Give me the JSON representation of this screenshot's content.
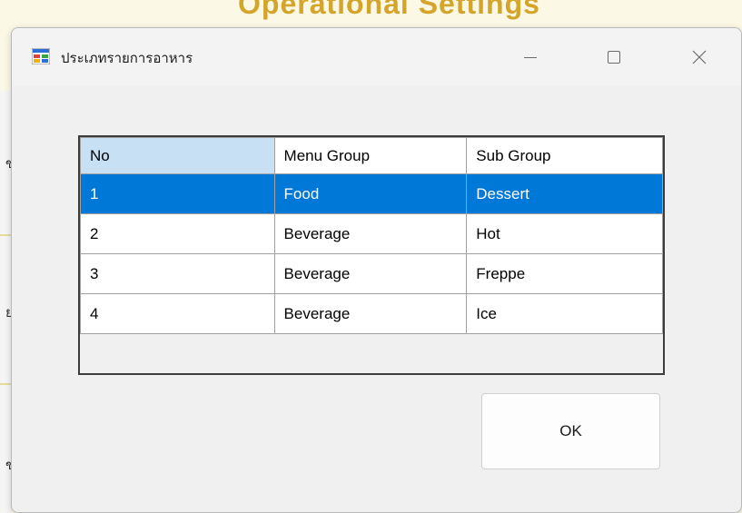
{
  "background_window": {
    "title_fragment": "Operational Settings",
    "edge_glyphs": [
      "ข",
      "ย",
      "ข"
    ]
  },
  "dialog": {
    "title": "ประเภทรายการอาหาร",
    "icon": "windows-form-icon",
    "controls": {
      "minimize": "minimize-icon",
      "maximize": "maximize-icon",
      "close": "close-icon"
    }
  },
  "grid": {
    "columns": [
      "No",
      "Menu Group",
      "Sub Group"
    ],
    "rows": [
      {
        "no": "1",
        "menu_group": "Food",
        "sub_group": "Dessert",
        "selected": true
      },
      {
        "no": "2",
        "menu_group": "Beverage",
        "sub_group": "Hot",
        "selected": false
      },
      {
        "no": "3",
        "menu_group": "Beverage",
        "sub_group": "Freppe",
        "selected": false
      },
      {
        "no": "4",
        "menu_group": "Beverage",
        "sub_group": "Ice",
        "selected": false
      }
    ]
  },
  "buttons": {
    "ok_label": "OK"
  },
  "colors": {
    "selection": "#0078d7",
    "header_highlight": "#c7e0f4",
    "background_title": "#d4a52a"
  }
}
